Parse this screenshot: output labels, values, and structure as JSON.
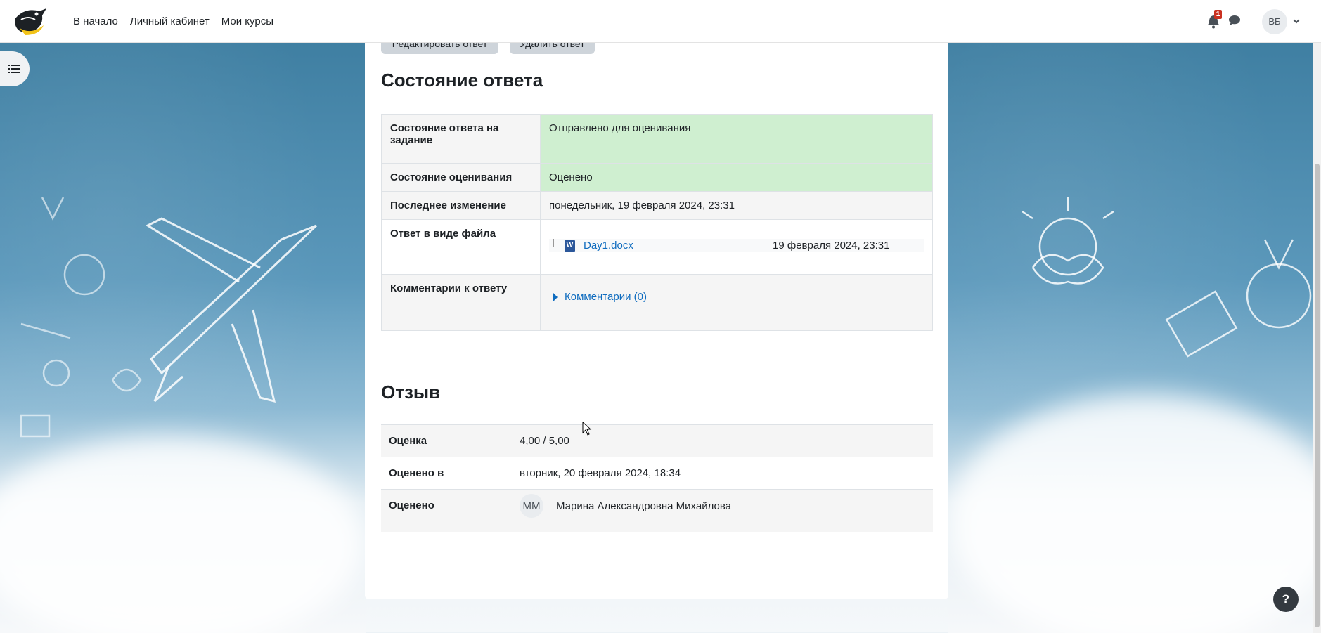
{
  "navbar": {
    "links": [
      "В начало",
      "Личный кабинет",
      "Мои курсы"
    ],
    "notification_count": "1",
    "user_initials": "ВБ"
  },
  "top_buttons": {
    "edit": "Редактировать ответ",
    "delete": "Удалить ответ"
  },
  "submission": {
    "title": "Состояние ответа",
    "rows": [
      {
        "label": "Состояние ответа на задание",
        "value": "Отправлено для оценивания"
      },
      {
        "label": "Состояние оценивания",
        "value": "Оценено"
      },
      {
        "label": "Последнее изменение",
        "value": "понедельник, 19 февраля 2024, 23:31"
      },
      {
        "label": "Ответ в виде файла",
        "file_name": "Day1.docx",
        "file_date": "19 февраля 2024, 23:31"
      },
      {
        "label": "Комментарии к ответу",
        "value": "Комментарии (0)"
      }
    ]
  },
  "feedback": {
    "title": "Отзыв",
    "rows": [
      {
        "label": "Оценка",
        "value": "4,00 / 5,00"
      },
      {
        "label": "Оценено в",
        "value": "вторник, 20 февраля 2024, 18:34"
      },
      {
        "label": "Оценено",
        "grader_initials": "ММ",
        "grader_name": "Марина Александровна Михайлова"
      }
    ]
  },
  "help_label": "?",
  "colors": {
    "accent_link": "#0f6cbf",
    "status_ok": "#cfefd0",
    "notification_badge": "#ca3120"
  }
}
